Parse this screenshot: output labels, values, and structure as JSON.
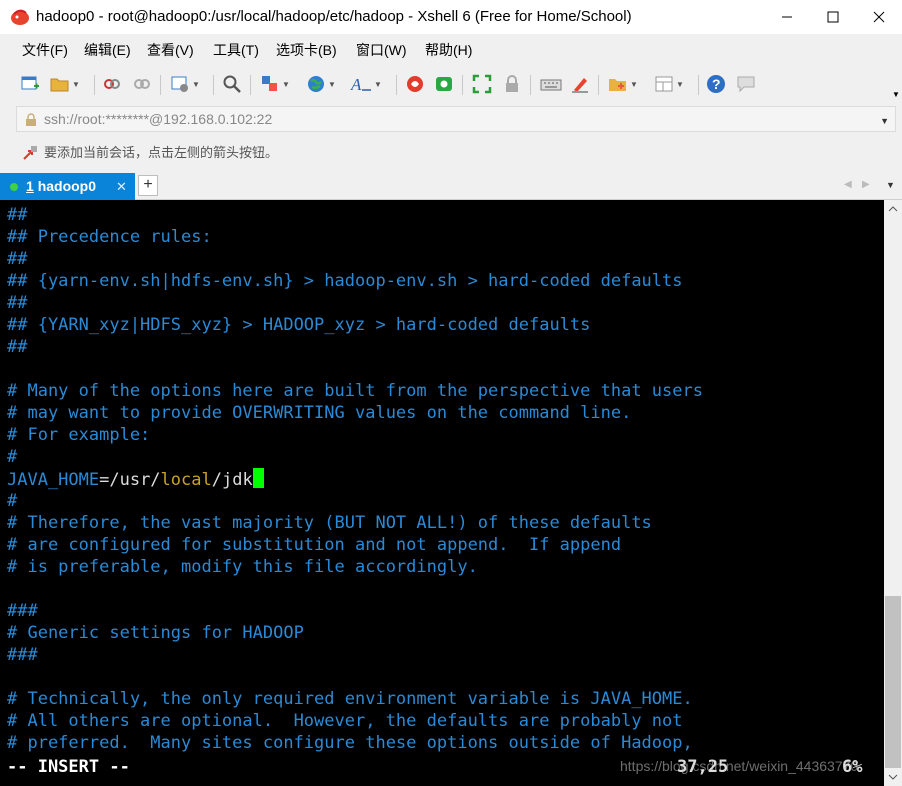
{
  "window": {
    "title": "hadoop0 - root@hadoop0:/usr/local/hadoop/etc/hadoop - Xshell 6 (Free for Home/School)"
  },
  "menu": [
    "文件(F)",
    "编辑(E)",
    "查看(V)",
    "工具(T)",
    "选项卡(B)",
    "窗口(W)",
    "帮助(H)"
  ],
  "address": {
    "value": "ssh://root:********@192.168.0.102:22"
  },
  "hint": {
    "text": "要添加当前会话，点击左侧的箭头按钮。"
  },
  "tabs": [
    {
      "number": "1",
      "name": "hadoop0",
      "close": "✕"
    }
  ],
  "newtab": "+",
  "terminal": {
    "lines": [
      [
        {
          "t": "##",
          "c": "blue"
        }
      ],
      [
        {
          "t": "## Precedence rules:",
          "c": "blue"
        }
      ],
      [
        {
          "t": "##",
          "c": "blue"
        }
      ],
      [
        {
          "t": "## {yarn-env.sh|hdfs-env.sh} > hadoop-env.sh > hard-coded defaults",
          "c": "blue"
        }
      ],
      [
        {
          "t": "##",
          "c": "blue"
        }
      ],
      [
        {
          "t": "## {YARN_xyz|HDFS_xyz} > HADOOP_xyz > hard-coded defaults",
          "c": "blue"
        }
      ],
      [
        {
          "t": "##",
          "c": "blue"
        }
      ],
      [
        {
          "t": "",
          "c": "blue"
        }
      ],
      [
        {
          "t": "# Many of the options here are built from the perspective that users",
          "c": "blue"
        }
      ],
      [
        {
          "t": "# may want to provide OVERWRITING values on the command line.",
          "c": "blue"
        }
      ],
      [
        {
          "t": "# For example:",
          "c": "blue"
        }
      ],
      [
        {
          "t": "#",
          "c": "blue"
        }
      ],
      [
        {
          "t": "JAVA_HOME",
          "c": "blue"
        },
        {
          "t": "=/usr/",
          "c": "white"
        },
        {
          "t": "local",
          "c": "yellow"
        },
        {
          "t": "/jdk",
          "c": "white"
        }
      ],
      [
        {
          "t": "#",
          "c": "blue"
        }
      ],
      [
        {
          "t": "# Therefore, the vast majority (BUT NOT ALL!) of these defaults",
          "c": "blue"
        }
      ],
      [
        {
          "t": "# are configured for substitution and not append.  If append",
          "c": "blue"
        }
      ],
      [
        {
          "t": "# is preferable, modify this file accordingly.",
          "c": "blue"
        }
      ],
      [
        {
          "t": "",
          "c": "blue"
        }
      ],
      [
        {
          "t": "###",
          "c": "blue"
        }
      ],
      [
        {
          "t": "# Generic settings for HADOOP",
          "c": "blue"
        }
      ],
      [
        {
          "t": "###",
          "c": "blue"
        }
      ],
      [
        {
          "t": "",
          "c": "blue"
        }
      ],
      [
        {
          "t": "# Technically, the only required environment variable is JAVA_HOME.",
          "c": "blue"
        }
      ],
      [
        {
          "t": "# All others are optional.  However, the defaults are probably not",
          "c": "blue"
        }
      ],
      [
        {
          "t": "# preferred.  Many sites configure these options outside of Hadoop,",
          "c": "blue"
        }
      ]
    ],
    "cursor_line": 12,
    "mode": "-- INSERT --",
    "position": "37,25",
    "percent": "6%",
    "watermark": "https://blog.csdn.net/weixin_44363770"
  },
  "colors": {
    "blue": "#2a8ad6",
    "white": "#dcdcdc",
    "yellow": "#c9a227",
    "tab": "#0a84d8",
    "cursor": "#00ff00"
  },
  "icons": [
    "app-logo-icon",
    "new-session-icon",
    "open-folder-icon",
    "disconnect-icon",
    "reconnect-icon",
    "properties-icon",
    "find-icon",
    "transfer-icon",
    "globe-icon",
    "font-icon",
    "xftp-icon",
    "xmanager-icon",
    "fullscreen-icon",
    "lock-icon",
    "keyboard-icon",
    "highlight-icon",
    "compose-icon",
    "layout-icon",
    "help-icon",
    "chat-icon"
  ]
}
